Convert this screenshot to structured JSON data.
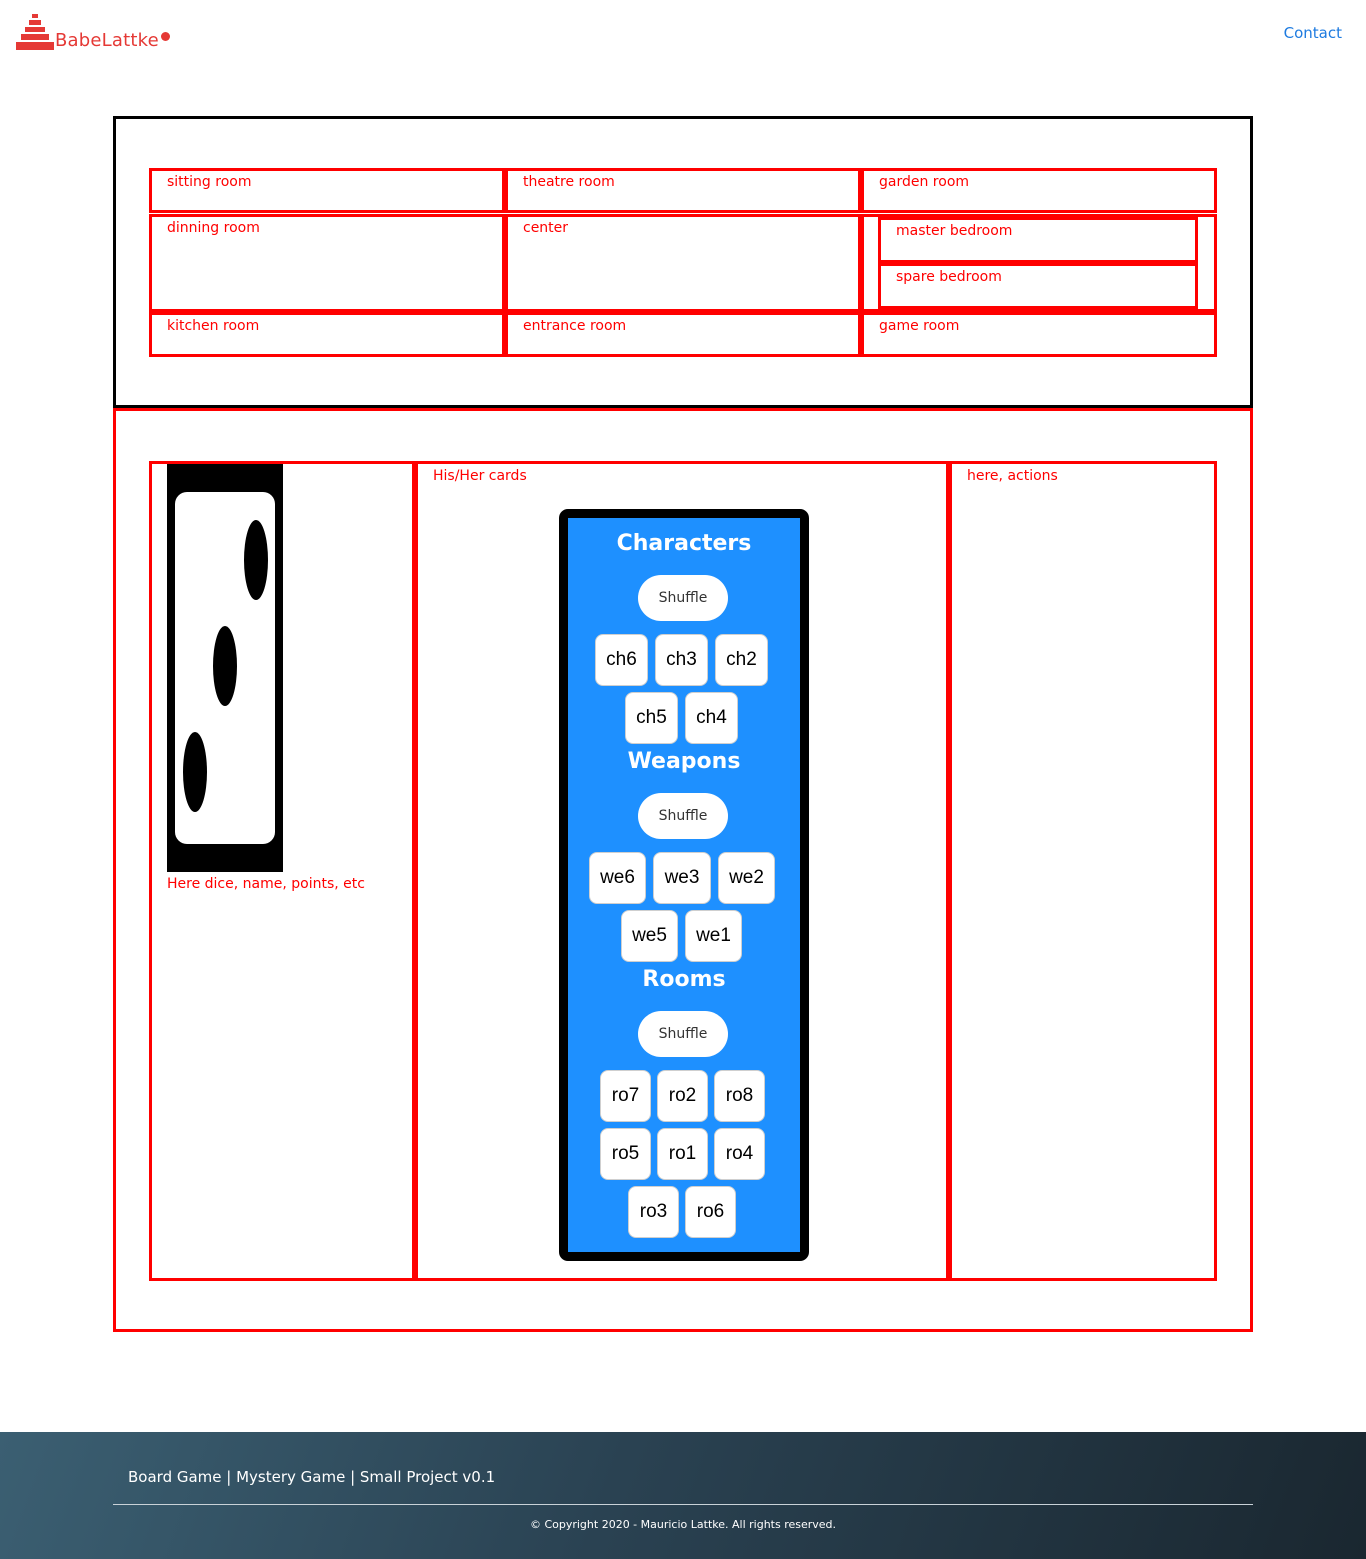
{
  "header": {
    "logo_text": "BabeLattke",
    "contact_label": "Contact",
    "brand_color": "#e53935"
  },
  "board": {
    "rooms": {
      "sitting": "sitting room",
      "theatre": "theatre room",
      "garden": "garden room",
      "dinning": "dinning room",
      "center": "center",
      "master": "master bedroom",
      "spare": "spare bedroom",
      "kitchen": "kitchen room",
      "entrance": "entrance room",
      "game": "game room"
    }
  },
  "player": {
    "dice_caption": "Here dice, name, points, etc",
    "dice_value": 3,
    "cards_label": "His/Her cards",
    "actions_label": "here, actions",
    "cards": {
      "characters_title": "Characters",
      "weapons_title": "Weapons",
      "rooms_title": "Rooms",
      "shuffle_label": "Shuffle",
      "characters": [
        "ch6",
        "ch3",
        "ch2",
        "ch5",
        "ch4"
      ],
      "weapons": [
        "we6",
        "we3",
        "we2",
        "we5",
        "we1"
      ],
      "rooms": [
        "ro7",
        "ro2",
        "ro8",
        "ro5",
        "ro1",
        "ro4",
        "ro3",
        "ro6"
      ]
    }
  },
  "footer": {
    "title": "Board Game | Mystery Game | Small Project v0.1",
    "copyright": "© Copyright 2020 - Mauricio Lattke. All rights reserved."
  },
  "colors": {
    "board_border": "#000000",
    "room_border": "#ff0000",
    "card_panel": "#1e90ff",
    "link": "#1e7be0"
  }
}
